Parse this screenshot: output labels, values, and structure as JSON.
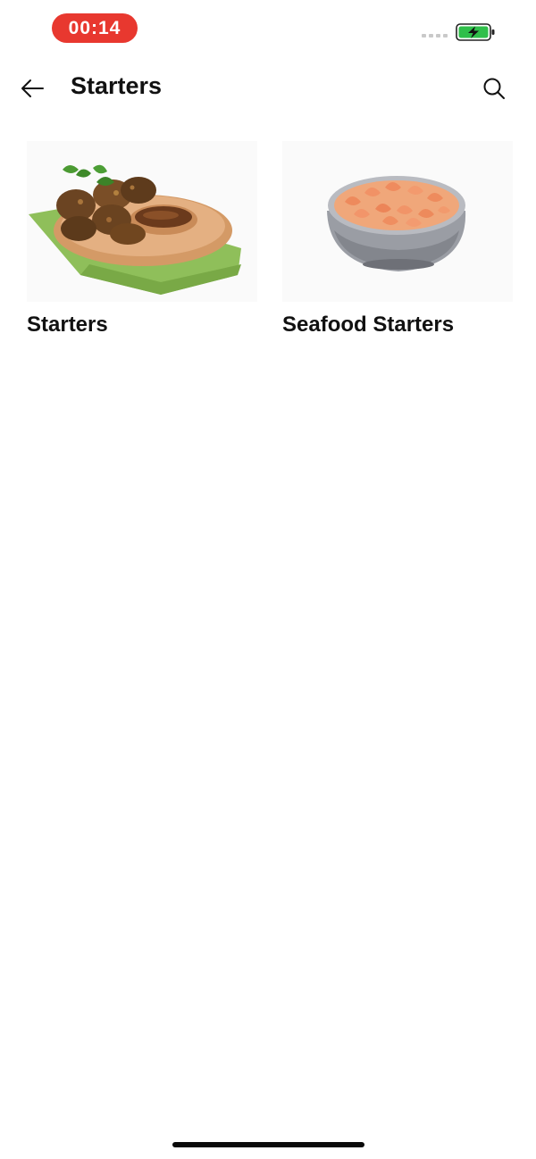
{
  "status_bar": {
    "time": "00:14",
    "time_pill_color": "#e8382f",
    "battery_color": "#2fbf4a"
  },
  "header": {
    "title": "Starters",
    "back_icon": "arrow-left-icon",
    "search_icon": "search-icon"
  },
  "categories": [
    {
      "label": "Starters",
      "image": "fried-fritters-with-dip-photo"
    },
    {
      "label": "Seafood Starters",
      "image": "shrimp-bowl-photo"
    }
  ]
}
